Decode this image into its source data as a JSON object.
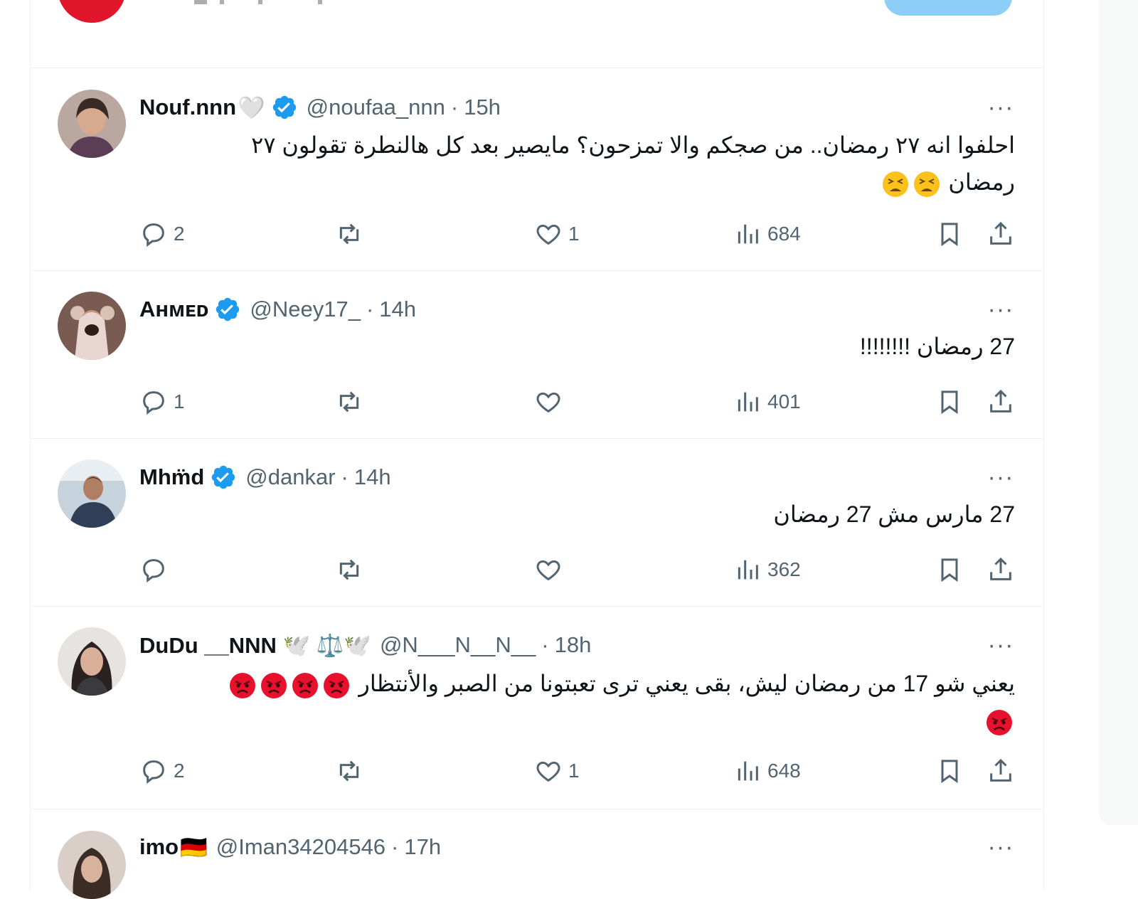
{
  "tweets": [
    {
      "name": "Nouf.nnn",
      "name_suffix": "🤍",
      "verified": true,
      "handle": "@noufaa_nnn",
      "time": "15h",
      "text_line1": "احلفوا انه ٢٧ رمضان.. من صجكم والا تمزحون؟ مايصير بعد كل هالنطرة تقولون ٢٧",
      "text_line2": "رمضان",
      "emoji_tail": [
        "tired-face",
        "tired-face"
      ],
      "replies": "2",
      "retweets": "",
      "likes": "1",
      "views": "684"
    },
    {
      "name": "Aʜᴍᴇᴅ",
      "verified": true,
      "handle": "@Neey17_",
      "time": "14h",
      "text_line1": "27 رمضان !!!!!!!!",
      "replies": "1",
      "retweets": "",
      "likes": "",
      "views": "401"
    },
    {
      "name": "Mhm̈d",
      "verified": true,
      "handle": "@dankar",
      "time": "14h",
      "text_line1": "27 مارس مش 27 رمضان",
      "replies": "",
      "retweets": "",
      "likes": "",
      "views": "362"
    },
    {
      "name": "DuDu __NNN 🕊️ ⚖️🕊️",
      "verified": false,
      "handle": "@N___N__N__",
      "time": "18h",
      "text_line1": "يعني شو 17 من رمضان ليش، بقى يعني ترى تعبتونا من الصبر والأنتظار",
      "emoji_inline": [
        "angry-face",
        "angry-face",
        "angry-face",
        "angry-face"
      ],
      "emoji_line2": [
        "angry-face"
      ],
      "replies": "2",
      "retweets": "",
      "likes": "1",
      "views": "648"
    },
    {
      "name": "imo",
      "name_suffix": "🇩🇪",
      "verified": false,
      "handle": "@Iman34204546",
      "time": "17h"
    }
  ],
  "colors": {
    "verified_blue": "#1d9bf0",
    "muted_text": "#536471",
    "divider": "#eff3f4",
    "top_button": "#8ecdf8"
  },
  "icons": {
    "reply": "reply-icon",
    "retweet": "retweet-icon",
    "like": "heart-icon",
    "views": "views-icon",
    "bookmark": "bookmark-icon",
    "share": "share-icon",
    "more": "more-icon"
  },
  "more_label": "···"
}
